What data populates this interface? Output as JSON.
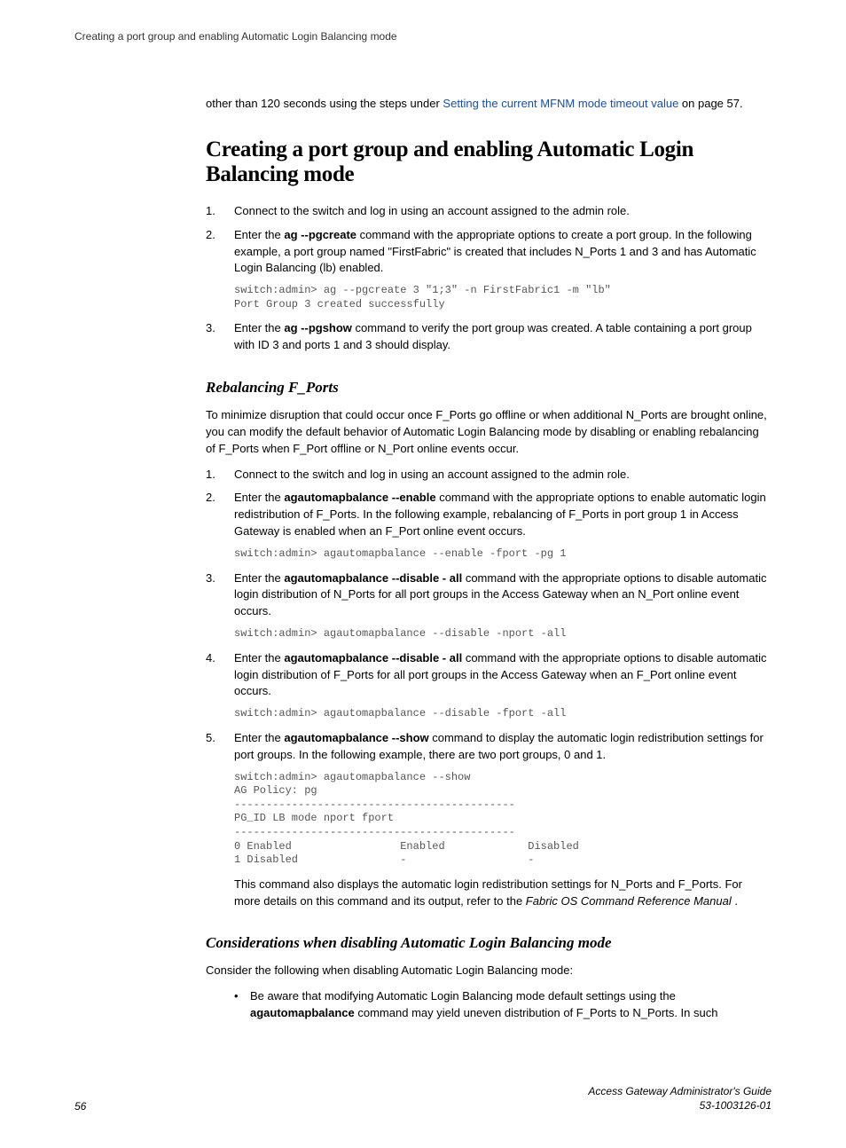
{
  "header": {
    "breadcrumb": "Creating a port group and enabling Automatic Login Balancing mode"
  },
  "intro": {
    "pre_link": "other than 120 seconds using the steps under ",
    "link_text": "Setting the current MFNM mode timeout value",
    "post_link": " on page 57."
  },
  "heading_main": "Creating a port group and enabling Automatic Login Balancing mode",
  "steps_a": {
    "s1": "Connect to the switch and log in using an account assigned to the admin role.",
    "s2_pre": "Enter the ",
    "s2_cmd": "ag --pgcreate",
    "s2_post": " command with the appropriate options to create a port group. In the following example, a port group named \"FirstFabric\" is created that includes N_Ports 1 and 3 and has Automatic Login Balancing (lb) enabled.",
    "s2_code": "switch:admin> ag --pgcreate 3 \"1;3\" -n FirstFabric1 -m \"lb\"\nPort Group 3 created successfully",
    "s3_pre": "Enter the ",
    "s3_cmd": "ag --pgshow",
    "s3_post": " command to verify the port group was created. A table containing a port group with ID 3 and ports 1 and 3 should display."
  },
  "heading_rebalance": "Rebalancing F_Ports",
  "rebalance_intro": "To minimize disruption that could occur once F_Ports go offline or when additional N_Ports are brought online, you can modify the default behavior of Automatic Login Balancing mode by disabling or enabling rebalancing of F_Ports when F_Port offline or N_Port online events occur.",
  "steps_b": {
    "s1": "Connect to the switch and log in using an account assigned to the admin role.",
    "s2_pre": "Enter the ",
    "s2_cmd": "agautomapbalance --enable",
    "s2_post": " command with the appropriate options to enable automatic login redistribution of F_Ports. In the following example, rebalancing of F_Ports in port group 1 in Access Gateway is enabled when an F_Port online event occurs.",
    "s2_code": "switch:admin> agautomapbalance --enable -fport -pg 1",
    "s3_pre": "Enter the ",
    "s3_cmd": "agautomapbalance --disable - all",
    "s3_post": " command with the appropriate options to disable automatic login distribution of N_Ports for all port groups in the Access Gateway when an N_Port online event occurs.",
    "s3_code": "switch:admin> agautomapbalance --disable -nport -all",
    "s4_pre": "Enter the ",
    "s4_cmd": "agautomapbalance --disable - all",
    "s4_post": " command with the appropriate options to disable automatic login distribution of F_Ports for all port groups in the Access Gateway when an F_Port online event occurs.",
    "s4_code": "switch:admin> agautomapbalance --disable -fport -all",
    "s5_pre": "Enter the ",
    "s5_cmd": "agautomapbalance --show",
    "s5_post": " command to display the automatic login redistribution settings for port groups. In the following example, there are two port groups, 0 and 1.",
    "s5_code": "switch:admin> agautomapbalance --show\nAG Policy: pg\n--------------------------------------------\nPG_ID LB mode nport fport\n--------------------------------------------\n0 Enabled                 Enabled             Disabled\n1 Disabled                -                   -",
    "s5_after_pre": "This command also displays the automatic login redistribution settings for N_Ports and F_Ports. For more details on this command and its output, refer to the ",
    "s5_after_ital": "Fabric OS Command Reference Manual",
    "s5_after_post": " ."
  },
  "heading_consider": "Considerations when disabling Automatic Login Balancing mode",
  "consider_intro": "Consider the following when disabling Automatic Login Balancing mode:",
  "consider_bullet": {
    "pre": "Be aware that modifying Automatic Login Balancing mode default settings using the ",
    "cmd": "agautomapbalance",
    "post": " command may yield uneven distribution of F_Ports to N_Ports. In such"
  },
  "footer": {
    "page_num": "56",
    "guide": "Access Gateway Administrator's Guide",
    "doc_id": "53-1003126-01"
  }
}
